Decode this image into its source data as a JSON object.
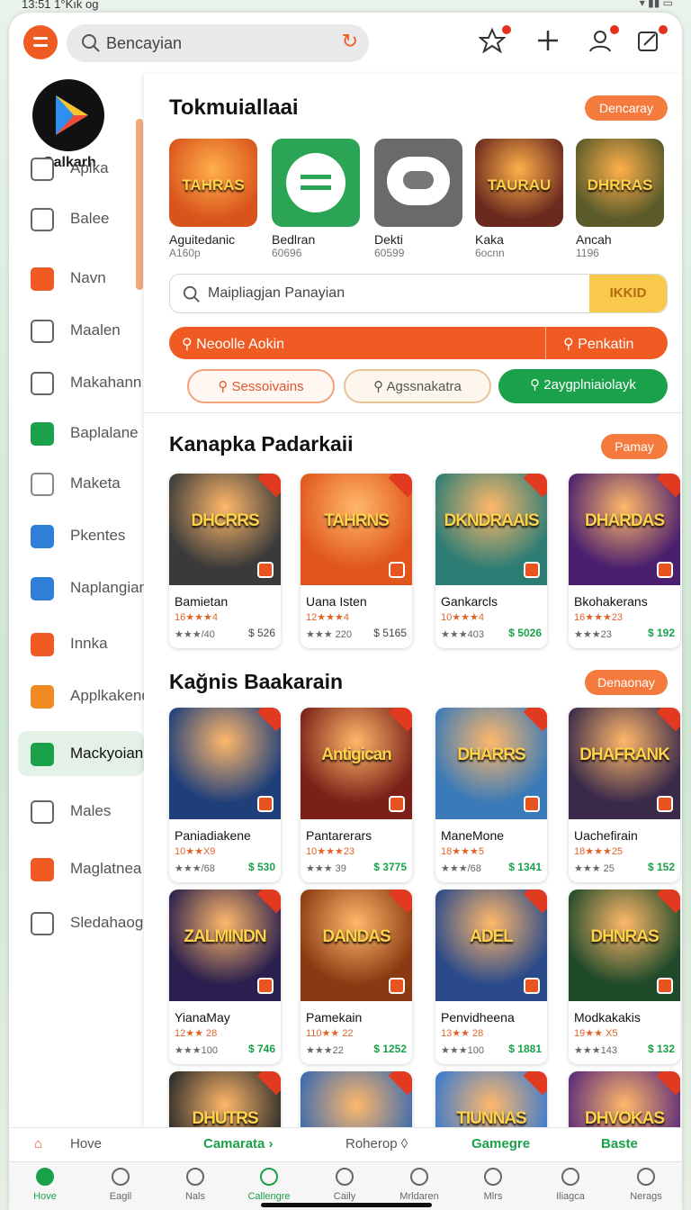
{
  "status": {
    "time": "13:51 1°Kık og",
    "icons": "wifi-signal battery"
  },
  "header": {
    "search_placeholder": "Bencayian",
    "icons": [
      "star-icon",
      "plus-icon",
      "people-icon",
      "edit-icon"
    ]
  },
  "sidebar": {
    "logo_label": "Galkarh",
    "items": [
      {
        "label": "Aplka",
        "icon": "bookmark-icon",
        "color": "#666666"
      },
      {
        "label": "Balee",
        "icon": "home-icon",
        "color": "#666666"
      },
      {
        "label": "Navn",
        "icon": "apps-icon",
        "color": "#f05a23"
      },
      {
        "label": "Maalen",
        "icon": "mail-icon",
        "color": "#666666"
      },
      {
        "label": "Makahann",
        "icon": "user-icon",
        "color": "#666666"
      },
      {
        "label": "Baplalane",
        "icon": "folder-icon",
        "color": "#1aa14a"
      },
      {
        "label": "Maketa",
        "icon": "check-circle-icon",
        "color": "#888888"
      },
      {
        "label": "Pkentes",
        "icon": "moon-icon",
        "color": "#2f7fd8"
      },
      {
        "label": "Naplangian",
        "icon": "download-icon",
        "color": "#2f7fd8"
      },
      {
        "label": "Innka",
        "icon": "bag-icon",
        "color": "#f05a23"
      },
      {
        "label": "Applkakend",
        "icon": "gift-icon",
        "color": "#f08a23"
      },
      {
        "label": "Mackyoiand",
        "icon": "list-icon",
        "color": "#1aa14a"
      },
      {
        "label": "Males",
        "icon": "card-icon",
        "color": "#666666"
      },
      {
        "label": "Maglatnea t",
        "icon": "bag-icon",
        "color": "#f05a23"
      },
      {
        "label": "Sledahaoga:",
        "icon": "checkbox-icon",
        "color": "#666666"
      }
    ]
  },
  "featured": {
    "title": "Tokmuiallaai",
    "button": "Dencaray",
    "apps": [
      {
        "name": "Aguitedanic",
        "sub": "A160p",
        "bg": "#d9541c",
        "tag": "TAHRAS"
      },
      {
        "name": "Bedlran",
        "sub": "60696",
        "bg": "#2ba555",
        "tag": ""
      },
      {
        "name": "Dekti",
        "sub": "60599",
        "bg": "#6a6a6a",
        "tag": ""
      },
      {
        "name": "Kaka",
        "sub": "6ocnn",
        "bg": "#6b2a1e",
        "tag": "TAURAU"
      },
      {
        "name": "Ancah",
        "sub": "1196",
        "bg": "#5a5a2a",
        "tag": "DHRRAS"
      }
    ]
  },
  "search_bar": {
    "placeholder": "Maipliagjan Panayian",
    "button": "IKKID"
  },
  "action_bar": {
    "left": "Neoolle Aokin",
    "right": "Penkatin"
  },
  "chips": [
    "Sessoivains",
    "Agssnakatra",
    "2aygplniaiolayk"
  ],
  "section2": {
    "title": "Kanapka Padarkaii",
    "button": "Pamay",
    "cards": [
      {
        "name": "Bamietan",
        "rating": "16★★★4",
        "stats": "★★★/40",
        "price": "$ 526",
        "green": false,
        "bg": "#3a3a3a",
        "tag": "DHCRRS"
      },
      {
        "name": "Uana Isten",
        "rating": "12★★★4",
        "stats": "★★★ 220",
        "price": "$ 5165",
        "green": false,
        "bg": "#e0561c",
        "tag": "TAHRNS"
      },
      {
        "name": "Gankarcls",
        "rating": "10★★★4",
        "stats": "★★★403",
        "price": "$ 5026",
        "green": true,
        "bg": "#2e7d75",
        "tag": "DKNDRAAIS"
      },
      {
        "name": "Bkohakerans",
        "rating": "16★★★23",
        "stats": "★★★23",
        "price": "$ 192",
        "green": true,
        "bg": "#4a1f6e",
        "tag": "DHARDAS"
      }
    ]
  },
  "section3": {
    "title": "Kağnis Baakarain",
    "button": "Denaonay",
    "cards": [
      {
        "name": "Paniadiakene",
        "rating": "10★★X9",
        "stats": "★★★/68",
        "price": "$ 530",
        "green": true,
        "bg": "#1f3f7a",
        "tag": ""
      },
      {
        "name": "Pantarerars",
        "rating": "10★★★23",
        "stats": "★★★ 39",
        "price": "$ 3775",
        "green": true,
        "bg": "#7a2018",
        "tag": "Antigican"
      },
      {
        "name": "ManeMone",
        "rating": "18★★★5",
        "stats": "★★★/68",
        "price": "$ 1341",
        "green": true,
        "bg": "#3a7ab8",
        "tag": "DHARRS"
      },
      {
        "name": "Uachefirain",
        "rating": "18★★★25",
        "stats": "★★★ 25",
        "price": "$ 152",
        "green": true,
        "bg": "#3a2a4a",
        "tag": "DHAFRANK"
      },
      {
        "name": "YianaMay",
        "rating": "12★★ 28",
        "stats": "★★★100",
        "price": "$ 746",
        "green": true,
        "bg": "#2a1f4e",
        "tag": "ZALMINDN"
      },
      {
        "name": "Pamekain",
        "rating": "110★★ 22",
        "stats": "★★★22",
        "price": "$ 1252",
        "green": true,
        "bg": "#8a3a12",
        "tag": "DANDAS"
      },
      {
        "name": "Penvidheena",
        "rating": "13★★ 28",
        "stats": "★★★100",
        "price": "$ 1881",
        "green": true,
        "bg": "#2a4a8a",
        "tag": "ADEL"
      },
      {
        "name": "Modkakakis",
        "rating": "19★★ X5",
        "stats": "★★★143",
        "price": "$ 132",
        "green": true,
        "bg": "#1f4a2a",
        "tag": "DHNRAS"
      },
      {
        "name": "",
        "rating": "",
        "stats": "",
        "price": "",
        "green": false,
        "bg": "#2a2a2a",
        "tag": "DHUTRS"
      },
      {
        "name": "",
        "rating": "",
        "stats": "",
        "price": "",
        "green": false,
        "bg": "#3a6ab0",
        "tag": ""
      },
      {
        "name": "",
        "rating": "",
        "stats": "",
        "price": "",
        "green": false,
        "bg": "#3a7ad0",
        "tag": "TIUNNAS"
      },
      {
        "name": "",
        "rating": "",
        "stats": "",
        "price": "",
        "green": false,
        "bg": "#5a2a7a",
        "tag": "DHVOKAS"
      }
    ]
  },
  "subnav": {
    "home": "Hove",
    "camarata": "Camarata ›",
    "roherop": "Roherop ◊",
    "gamegre": "Gamegre",
    "baste": "Baste"
  },
  "bottom_nav": [
    {
      "label": "Hove",
      "icon": "home-icon",
      "active": true
    },
    {
      "label": "Eagil",
      "icon": "face-icon",
      "active": false
    },
    {
      "label": "Nals",
      "icon": "book-icon",
      "active": false
    },
    {
      "label": "Callengre",
      "icon": "globe-icon",
      "active": true
    },
    {
      "label": "Caily",
      "icon": "compass-icon",
      "active": false
    },
    {
      "label": "Mrldaren",
      "icon": "cloud-icon",
      "active": false
    },
    {
      "label": "Mlrs",
      "icon": "calendar-icon",
      "active": false
    },
    {
      "label": "Iliagca",
      "icon": "search-icon",
      "active": false
    },
    {
      "label": "Nerags",
      "icon": "user-icon",
      "active": false
    }
  ]
}
